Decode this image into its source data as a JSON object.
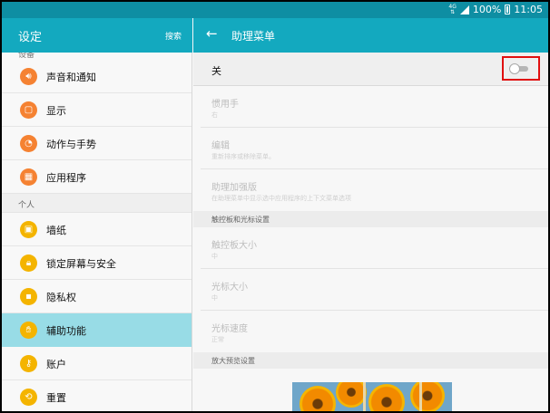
{
  "status_bar": {
    "network": "4G",
    "battery_percent": "100%",
    "time": "11:05"
  },
  "left_header": {
    "title": "设定",
    "search_label": "搜索"
  },
  "left_menu": {
    "cut_section": "设备",
    "items_top": [
      {
        "label": "声音和通知",
        "icon": "volume-icon",
        "color": "#f58232"
      },
      {
        "label": "显示",
        "icon": "display-icon",
        "color": "#f58232"
      },
      {
        "label": "动作与手势",
        "icon": "gesture-icon",
        "color": "#f58232"
      },
      {
        "label": "应用程序",
        "icon": "apps-icon",
        "color": "#f58232"
      }
    ],
    "section_personal": "个人",
    "items_personal": [
      {
        "label": "墙纸",
        "icon": "wallpaper-icon",
        "color": "#f4b400"
      },
      {
        "label": "锁定屏幕与安全",
        "icon": "lock-icon",
        "color": "#f4b400"
      },
      {
        "label": "隐私权",
        "icon": "privacy-icon",
        "color": "#f4b400"
      },
      {
        "label": "辅助功能",
        "icon": "accessibility-hand-icon",
        "color": "#f4b400"
      },
      {
        "label": "账户",
        "icon": "key-icon",
        "color": "#f4b400"
      },
      {
        "label": "重置",
        "icon": "reset-icon",
        "color": "#f4b400"
      }
    ],
    "selected": "辅助功能"
  },
  "right_header": {
    "title": "助理菜单"
  },
  "right_pane": {
    "master_switch_label": "关",
    "master_switch_on": false,
    "settings": [
      {
        "title": "惯用手",
        "subtitle": "右"
      },
      {
        "title": "编辑",
        "subtitle": "重新排序或移除菜单。"
      },
      {
        "title": "助理加强版",
        "subtitle": "在助理菜单中显示选中应用程序的上下文菜单选项"
      }
    ],
    "section_touchpad": "触控板和光标设置",
    "touchpad_settings": [
      {
        "title": "触控板大小",
        "subtitle": "中"
      },
      {
        "title": "光标大小",
        "subtitle": "中"
      },
      {
        "title": "光标速度",
        "subtitle": "正常"
      }
    ],
    "section_zoom": "放大预览设置"
  },
  "colors": {
    "header": "#13a9bf",
    "status_bar": "#0e8ea3",
    "selected_item": "#98dce6",
    "highlight_box": "#e01010"
  }
}
